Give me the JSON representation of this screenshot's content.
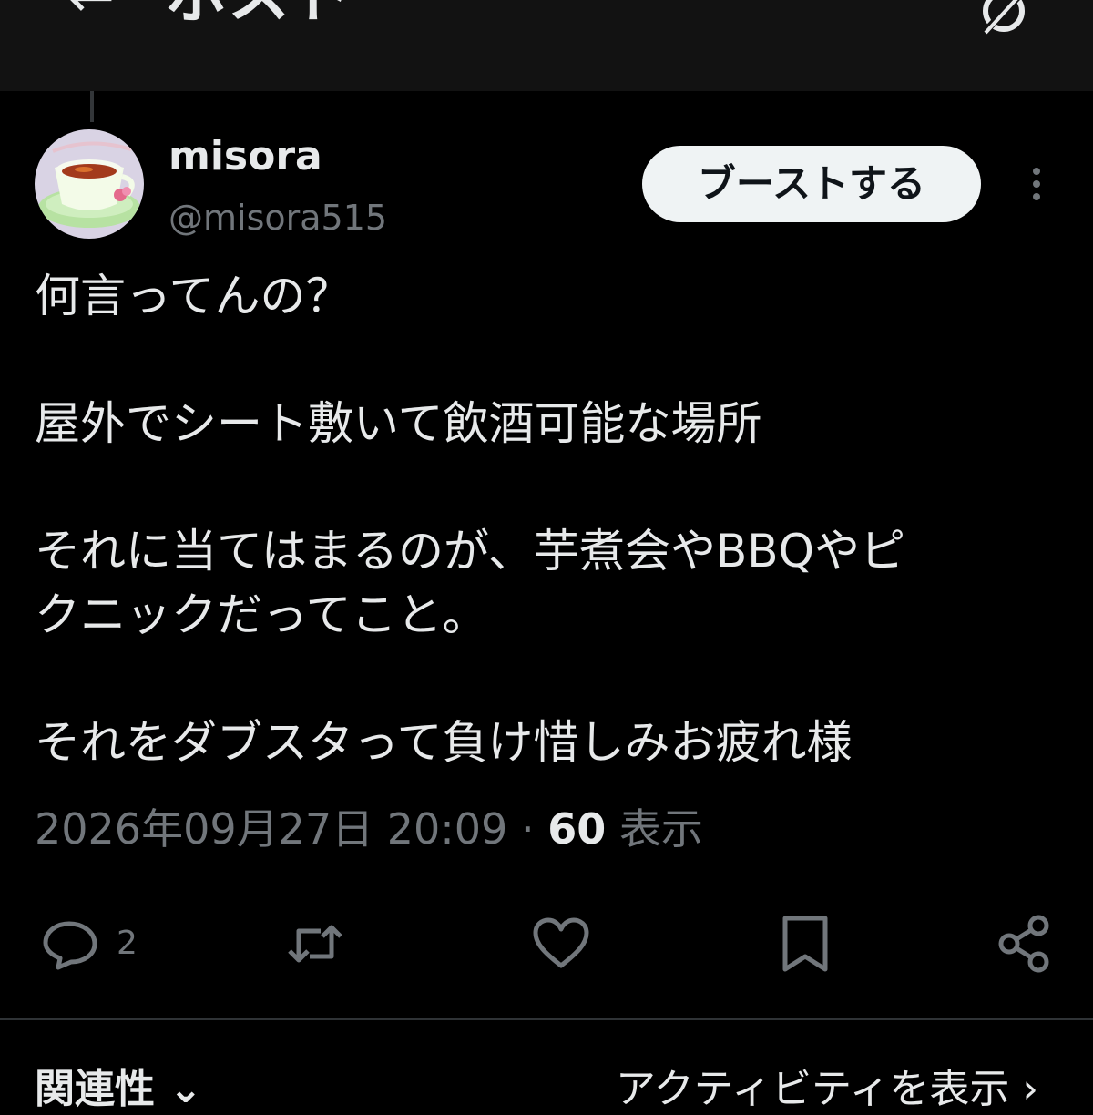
{
  "header": {
    "back_icon": "arrow-left-icon",
    "title": "ポスト",
    "grok_icon": "grok-icon"
  },
  "post": {
    "author": {
      "display_name": "misora",
      "handle": "@misora515",
      "avatar": "teacup-avatar"
    },
    "boost_label": "ブーストする",
    "lines": [
      "何言ってんの？",
      "",
      "屋外でシート敷いて飲酒可能な場所",
      "",
      "それに当てはまるのが、芋煮会やBBQやピ",
      "クニックだってこと。",
      "",
      "それをダブスタって負け惜しみお疲れ様"
    ],
    "timestamp": "2026年09月27日 20:09",
    "separator": "·",
    "views_count": "60",
    "views_label": "表示"
  },
  "actions": {
    "reply_count": "2",
    "icons": [
      "reply-icon",
      "repost-icon",
      "like-icon",
      "bookmark-icon",
      "share-icon"
    ]
  },
  "replies_bar": {
    "sort_label": "関連性 ⌄",
    "activity_label": "アクティビティを表示 ›"
  },
  "colors": {
    "background": "#000000",
    "header_background": "#121212",
    "text": "#e7e9ea",
    "muted": "#71767b",
    "button_bg": "#eff3f4",
    "button_text": "#0f1419"
  }
}
